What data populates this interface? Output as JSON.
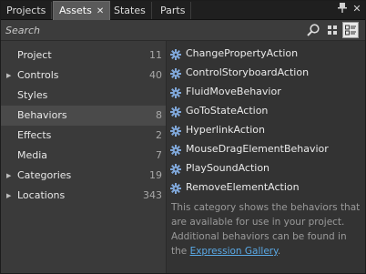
{
  "tabs": [
    {
      "label": "Projects"
    },
    {
      "label": "Assets",
      "close": "✕"
    },
    {
      "label": "States"
    },
    {
      "label": "Parts"
    }
  ],
  "window_controls": {
    "pin": "📌",
    "close": "✕"
  },
  "search": {
    "placeholder": "Search"
  },
  "categories": [
    {
      "label": "Project",
      "count": "11",
      "expandable": false
    },
    {
      "label": "Controls",
      "count": "40",
      "expandable": true
    },
    {
      "label": "Styles",
      "count": "",
      "expandable": false
    },
    {
      "label": "Behaviors",
      "count": "8",
      "expandable": false,
      "selected": true
    },
    {
      "label": "Effects",
      "count": "2",
      "expandable": false
    },
    {
      "label": "Media",
      "count": "7",
      "expandable": false
    },
    {
      "label": "Categories",
      "count": "19",
      "expandable": true
    },
    {
      "label": "Locations",
      "count": "343",
      "expandable": true
    }
  ],
  "behaviors": [
    {
      "label": "ChangePropertyAction"
    },
    {
      "label": "ControlStoryboardAction"
    },
    {
      "label": "FluidMoveBehavior"
    },
    {
      "label": "GoToStateAction"
    },
    {
      "label": "HyperlinkAction"
    },
    {
      "label": "MouseDragElementBehavior"
    },
    {
      "label": "PlaySoundAction"
    },
    {
      "label": "RemoveElementAction"
    }
  ],
  "description": {
    "text": "This category shows the behaviors that are available for use in your project. Additional behaviors can be found in the ",
    "link": "Expression Gallery",
    "suffix": "."
  },
  "colors": {
    "accent_link": "#5aa9e6",
    "selected_row": "#4a4a4a",
    "active_tab": "#5a5a5a"
  }
}
